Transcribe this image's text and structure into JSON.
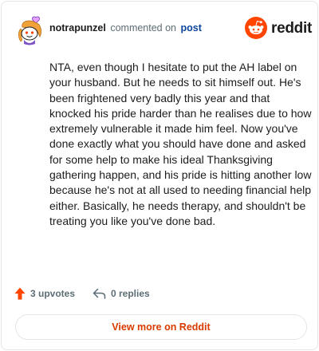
{
  "comment": {
    "username": "notrapunzel",
    "action_text": "commented on",
    "target_link": "post",
    "body": "NTA, even though I hesitate to put the AH label on your husband. But he needs to sit himself out. He's been frightened very badly this year and that knocked his pride harder than he realises due to how extremely vulnerable it made him feel. Now you've done exactly what you should have done and asked for some help to make his ideal Thanksgiving gathering happen, and his pride is hitting another low because he's not at all used to needing financial help either. Basically, he needs therapy, and shouldn't be treating you like you've done bad."
  },
  "brand": {
    "wordmark": "reddit",
    "color": "#FF4500"
  },
  "actions": {
    "upvotes": "3 upvotes",
    "replies": "0 replies"
  },
  "footer": {
    "view_more": "View more on Reddit"
  },
  "colors": {
    "accent": "#D93A00",
    "link": "#0A449B",
    "muted": "#5C6C74"
  }
}
